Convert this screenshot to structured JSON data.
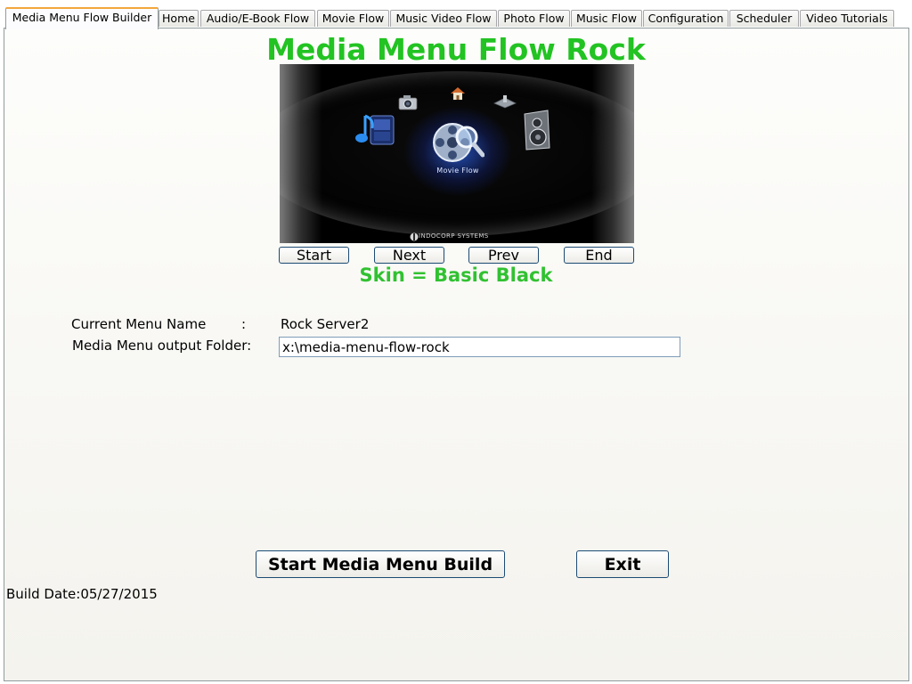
{
  "tabs": [
    {
      "label": "Media Menu Flow Builder",
      "active": true
    },
    {
      "label": "Home"
    },
    {
      "label": "Audio/E-Book Flow"
    },
    {
      "label": "Movie Flow"
    },
    {
      "label": "Music Video Flow"
    },
    {
      "label": "Photo Flow"
    },
    {
      "label": "Music Flow"
    },
    {
      "label": "Configuration"
    },
    {
      "label": "Scheduler"
    },
    {
      "label": "Video Tutorials"
    }
  ],
  "header": {
    "title": "Media Menu Flow Rock"
  },
  "preview": {
    "center_caption": "Movie Flow",
    "vendor_text": "INDOCORP SYSTEMS",
    "icons": [
      "music-note-icon",
      "camera-icon",
      "home-icon",
      "network-icon",
      "speaker-icon",
      "film-reel-icon"
    ]
  },
  "nav_buttons": {
    "start": "Start",
    "next": "Next",
    "prev": "Prev",
    "end": "End"
  },
  "skin_label": "Skin = Basic Black",
  "form": {
    "current_menu_label": "Current Menu Name",
    "colon": ":",
    "current_menu_value": "Rock Server2",
    "output_folder_label": "Media Menu output Folder:",
    "output_folder_value": "x:\\media-menu-flow-rock"
  },
  "actions": {
    "build": "Start Media Menu Build",
    "exit": "Exit"
  },
  "footer": {
    "build_date": "Build Date:05/27/2015"
  },
  "colors": {
    "title_green": "#22c322",
    "skin_green": "#31c131",
    "active_tab_accent": "#f3a63c"
  }
}
